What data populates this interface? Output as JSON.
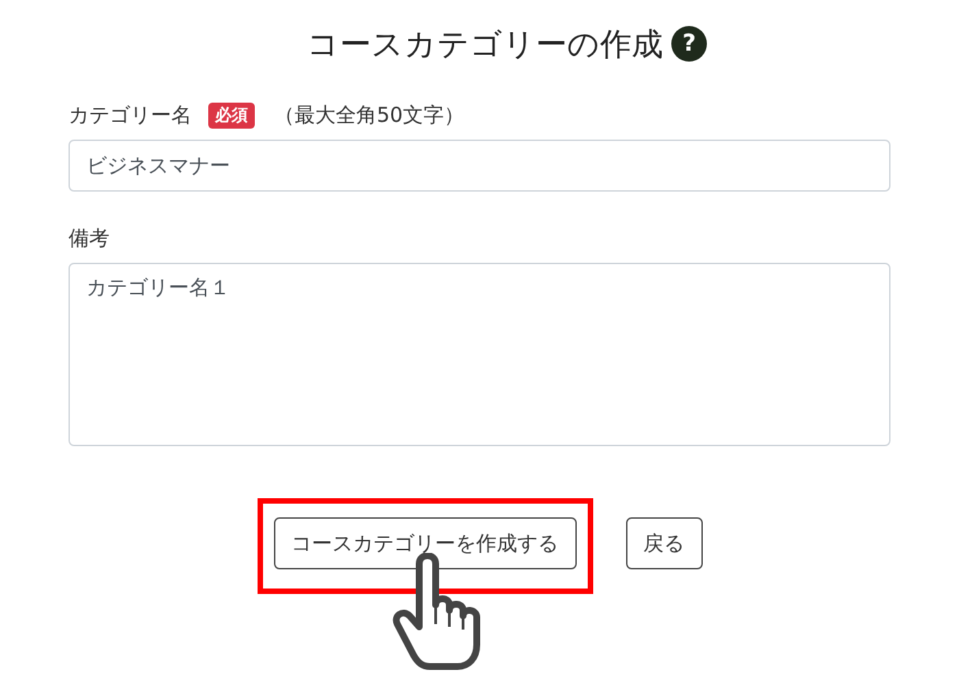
{
  "page": {
    "title": "コースカテゴリーの作成",
    "help_icon": "?"
  },
  "fields": [
    {
      "kind": "input",
      "label": "カテゴリー名",
      "badge": "必須",
      "hint": "（最大全角50文字）",
      "value": "ビジネスマナー"
    },
    {
      "kind": "textarea",
      "label": "備考",
      "value": "カテゴリー名１"
    }
  ],
  "buttons": [
    {
      "label": "コースカテゴリーを作成する",
      "highlighted": true
    },
    {
      "label": "戻る",
      "highlighted": false
    }
  ]
}
